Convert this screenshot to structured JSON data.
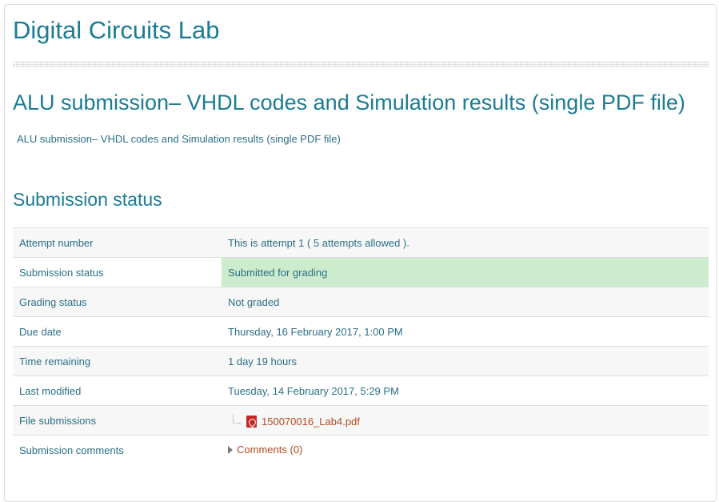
{
  "course": {
    "title": "Digital Circuits Lab"
  },
  "assignment": {
    "title": "ALU submission– VHDL codes and Simulation results (single PDF file)",
    "intro": "ALU submission– VHDL codes and Simulation results (single PDF file)"
  },
  "submission_status": {
    "heading": "Submission status",
    "rows": [
      {
        "label": "Attempt number",
        "value": "This is attempt 1 ( 5 attempts allowed )."
      },
      {
        "label": "Submission status",
        "value": "Submitted for grading"
      },
      {
        "label": "Grading status",
        "value": "Not graded"
      },
      {
        "label": "Due date",
        "value": "Thursday, 16 February 2017, 1:00 PM"
      },
      {
        "label": "Time remaining",
        "value": "1 day 19 hours"
      },
      {
        "label": "Last modified",
        "value": "Tuesday, 14 February 2017, 5:29 PM"
      },
      {
        "label": "File submissions",
        "file": {
          "name": "150070016_Lab4.pdf",
          "icon": "pdf-icon"
        }
      },
      {
        "label": "Submission comments",
        "comments": {
          "link": "Comments (0)",
          "icon": "triangle-right-icon"
        }
      }
    ]
  },
  "colors": {
    "heading": "#1b7c94",
    "link": "#2b6f86",
    "submitted_bg": "#cdeccd",
    "file_link": "#b14a1e"
  }
}
